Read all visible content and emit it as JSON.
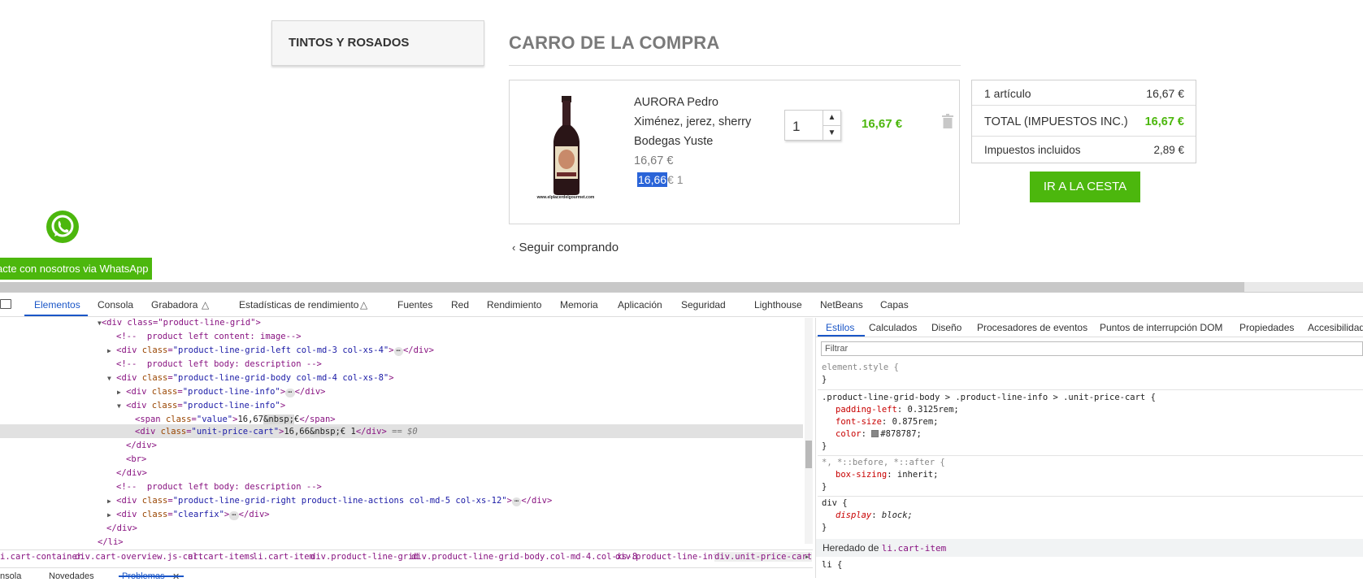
{
  "sidebar": {
    "category_title": "TINTOS Y ROSADOS"
  },
  "cart": {
    "title": "CARRO DE LA COMPRA",
    "product": {
      "name_line1": "AURORA Pedro",
      "name_line2": "Ximénez, jerez, sherry",
      "name_line3": "Bodegas Yuste",
      "price": "16,67 €",
      "unit_price_selected": "16,66",
      "unit_price_rest": "€ 1",
      "image_caption": "www.elplacerdelgourmet.com",
      "quantity": "1",
      "line_total": "16,67 €"
    },
    "continue_label": "Seguir comprando"
  },
  "summary": {
    "items_label": "1 artículo",
    "items_value": "16,67 €",
    "total_label": "TOTAL (IMPUESTOS INC.)",
    "total_value": "16,67 €",
    "taxes_label": "Impuestos incluidos",
    "taxes_value": "2,89 €",
    "checkout_label": "IR A LA CESTA"
  },
  "whatsapp": {
    "button_label": "acte con nosotros via WhatsApp"
  },
  "devtools": {
    "tabs": [
      "Elementos",
      "Consola",
      "Grabadora",
      "Estadísticas de rendimiento",
      "Fuentes",
      "Red",
      "Rendimiento",
      "Memoria",
      "Aplicación",
      "Seguridad",
      "Lighthouse",
      "NetBeans",
      "Capas"
    ],
    "dom": {
      "l1": "<div class=\"product-line-grid\">",
      "l2": "<!--  product left content: image-->",
      "l3_open": "<div ",
      "l3_attr": "class",
      "l3_val": "\"product-line-grid-left col-md-3 col-xs-4\"",
      "l3_close": "</div>",
      "l4": "<!--  product left body: description -->",
      "l5_attr": "class",
      "l5_val": "\"product-line-grid-body col-md-4 col-xs-8\"",
      "l6_val": "\"product-line-info\"",
      "l7_val": "\"product-line-info\"",
      "l8_span_val": "\"value\"",
      "l8_text": "16,67",
      "l8_nbsp": "&nbsp;",
      "l8_euro": "€",
      "l9_val": "\"unit-price-cart\"",
      "l9_text": "16,66",
      "l9_nbsp": "&nbsp;",
      "l9_rest": "€ 1",
      "l9_eq": "== $0",
      "l10": "</div>",
      "l11": "<br>",
      "l12": "</div>",
      "l13": "<!--  product left body: description -->",
      "l14_val": "\"product-line-grid-right product-line-actions col-md-5 col-xs-12\"",
      "l15_val": "\"clearfix\"",
      "l16": "</div>",
      "l17": "</li>"
    },
    "breadcrumbs": [
      "i.cart-container",
      "div.cart-overview.js-cart",
      "ul.cart-items",
      "li.cart-item",
      "div.product-line-grid",
      "div.product-line-grid-body.col-md-4.col-xs-8",
      "div.product-line-info",
      "div.unit-price-cart"
    ],
    "drawer": [
      "Consola",
      "Novedades",
      "Problemas"
    ],
    "styles_tabs": [
      "Estilos",
      "Calculados",
      "Diseño",
      "Procesadores de eventos",
      "Puntos de interrupción DOM",
      "Propiedades",
      "Accesibilidad"
    ],
    "filter_placeholder": "Filtrar",
    "styles": {
      "element_style": "element.style {",
      "close": "}",
      "rule1_selector": ".product-line-grid-body > .product-line-info > .unit-price-cart {",
      "r1_p1": "padding-left",
      "r1_v1": "0.3125rem;",
      "r1_p2": "font-size",
      "r1_v2": "0.875rem;",
      "r1_p3": "color",
      "r1_v3": "#878787;",
      "rule2_selector": "*, *::before, *::after {",
      "r2_p1": "box-sizing",
      "r2_v1": "inherit;",
      "rule3_selector": "div {",
      "r3_p1": "display",
      "r3_v1": "block;",
      "inherited_label": "Heredado de",
      "inherited_from": "li.cart-item",
      "li_start": "li {"
    }
  },
  "colors": {
    "accent_green": "#4cb70d",
    "devtools_blue": "#1a56c7",
    "highlight": "#2a64d8"
  }
}
